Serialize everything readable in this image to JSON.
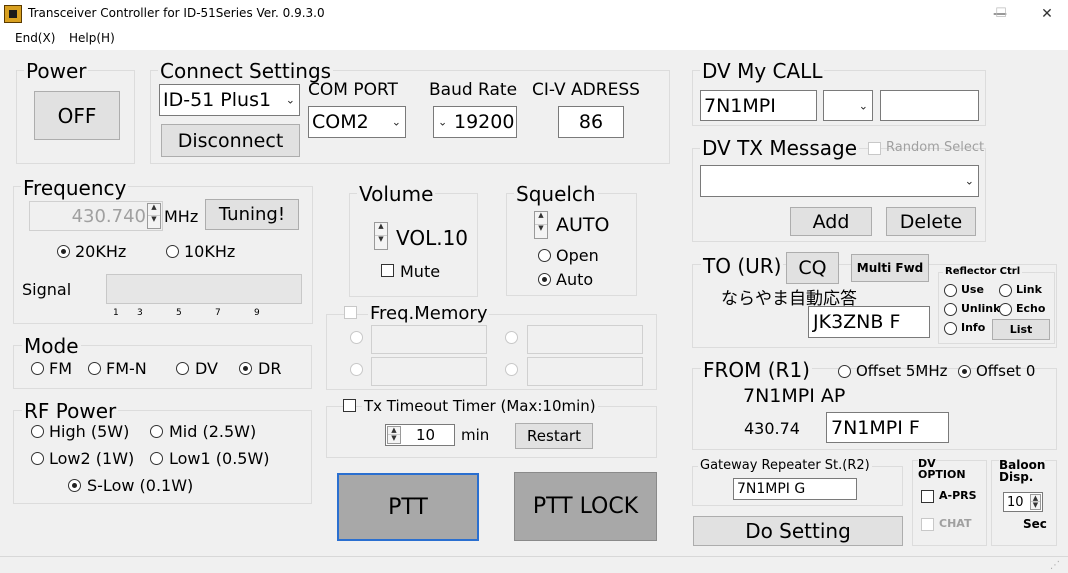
{
  "window": {
    "title": "Transceiver Controller for ID-51Series  Ver. 0.9.3.0",
    "minimize": "—",
    "maximize": "☐",
    "close": "✕"
  },
  "menu": [
    "End(X)",
    "Help(H)"
  ],
  "power": {
    "title": "Power",
    "button": "OFF"
  },
  "connect": {
    "title": "Connect Settings",
    "model": "ID-51 Plus1",
    "disconnect": "Disconnect",
    "com_label": "COM PORT",
    "com_value": "COM2",
    "baud_label": "Baud Rate",
    "baud_value": "19200",
    "civ_label": "CI-V ADRESS",
    "civ_value": "86"
  },
  "frequency": {
    "title": "Frequency",
    "value": "430.740",
    "unit": "MHz",
    "tuning": "Tuning!",
    "step_20": "20KHz",
    "step_10": "10KHz",
    "signal_label": "Signal",
    "scale": [
      "1",
      "3",
      "5",
      "7",
      "9"
    ]
  },
  "volume": {
    "title": "Volume",
    "value": "VOL.10",
    "mute": "Mute"
  },
  "squelch": {
    "title": "Squelch",
    "value": "AUTO",
    "open": "Open",
    "auto": "Auto"
  },
  "mode": {
    "title": "Mode",
    "options": [
      "FM",
      "FM-N",
      "DV",
      "DR"
    ]
  },
  "rf": {
    "title": "RF Power",
    "high": "High (5W)",
    "mid": "Mid (2.5W)",
    "low2": "Low2 (1W)",
    "low1": "Low1 (0.5W)",
    "slow": "S-Low (0.1W)"
  },
  "freqmem": {
    "title": "Freq.Memory"
  },
  "timeout": {
    "title": "Tx Timeout Timer (Max:10min)",
    "value": "10",
    "unit": "min",
    "restart": "Restart"
  },
  "ptt": {
    "ptt": "PTT",
    "lock": "PTT LOCK"
  },
  "mycall": {
    "title": "DV My CALL",
    "call": "7N1MPI"
  },
  "txmsg": {
    "title": "DV TX Message",
    "random": "Random Select",
    "add": "Add",
    "delete": "Delete"
  },
  "to": {
    "title": "TO (UR)",
    "cq": "CQ",
    "multi": "Multi Fwd",
    "jp_text": "ならやま自動応答",
    "ur_value": "JK3ZNB F"
  },
  "reflector": {
    "title": "Reflector Ctrl",
    "use": "Use",
    "link": "Link",
    "unlink": "Unlink",
    "echo": "Echo",
    "info": "Info",
    "list": "List"
  },
  "from": {
    "title": "FROM (R1)",
    "offset5": "Offset 5MHz",
    "offset0": "Offset 0",
    "rpt_name": "7N1MPI AP",
    "rpt_freq": "430.74",
    "r1_value": "7N1MPI F"
  },
  "gateway": {
    "title": "Gateway Repeater St.(R2)",
    "value": "7N1MPI G"
  },
  "dvopt": {
    "title1": "DV",
    "title2": "OPTION",
    "aprs": "A-PRS",
    "chat": "CHAT"
  },
  "baloon": {
    "title1": "Baloon",
    "title2": "Disp.",
    "value": "10",
    "unit": "Sec"
  },
  "do_setting": "Do Setting"
}
